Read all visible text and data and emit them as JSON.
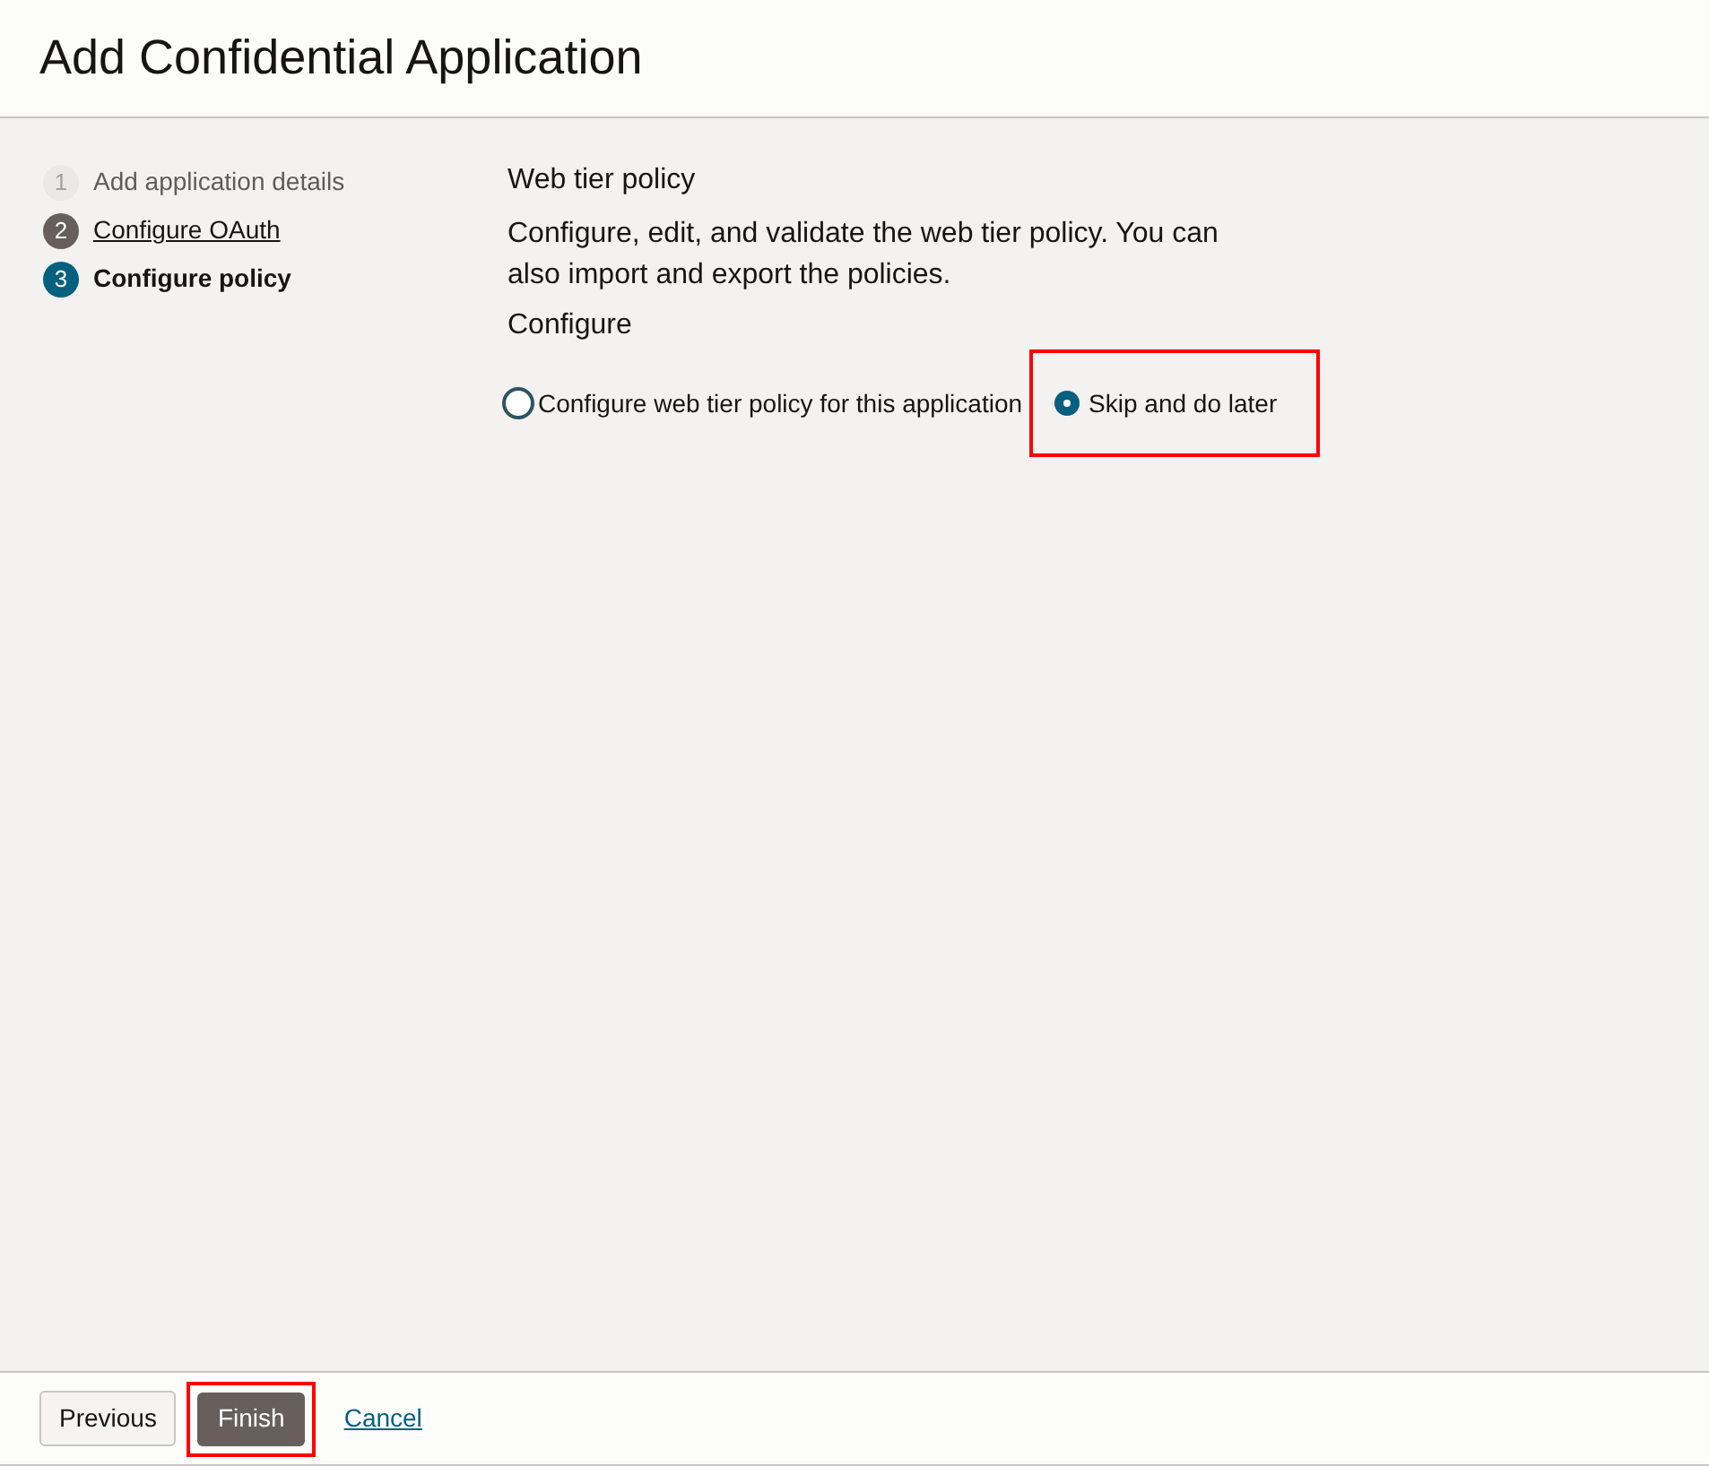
{
  "header": {
    "title": "Add Confidential Application"
  },
  "steps": [
    {
      "number": "1",
      "label": "Add application details",
      "disabled": true,
      "selected": false
    },
    {
      "number": "2",
      "label": "Configure OAuth",
      "disabled": false,
      "selected": false
    },
    {
      "number": "3",
      "label": "Configure policy",
      "disabled": false,
      "selected": true
    }
  ],
  "section": {
    "title": "Web tier policy",
    "description": "Configure, edit, and validate the web tier policy. You can also import and export the policies.",
    "group_label": "Configure",
    "options": [
      {
        "label": "Configure web tier policy for this application",
        "selected": false,
        "highlighted": false
      },
      {
        "label": "Skip and do later",
        "selected": true,
        "highlighted": true
      }
    ]
  },
  "footer": {
    "buttons": [
      {
        "label": "Previous",
        "kind": "secondary",
        "highlighted": false
      },
      {
        "label": "Finish",
        "kind": "primary",
        "highlighted": true
      },
      {
        "label": "Cancel",
        "kind": "link",
        "highlighted": false
      }
    ]
  }
}
